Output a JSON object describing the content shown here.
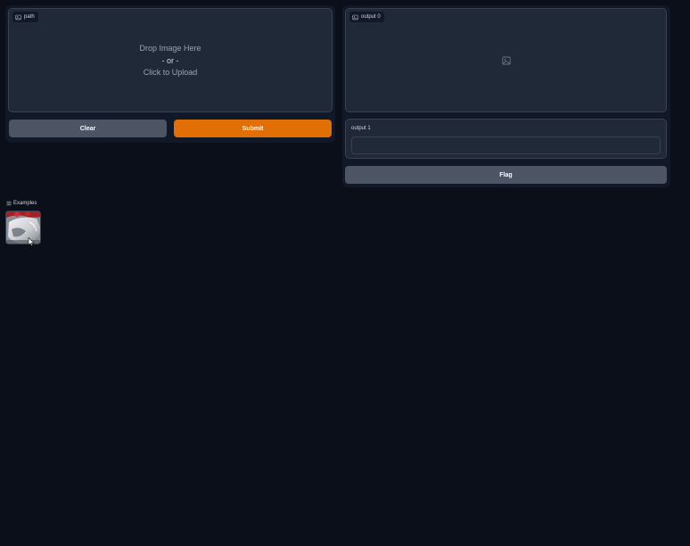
{
  "input_panel": {
    "image_label": "path",
    "drop_line1": "Drop Image Here",
    "drop_line2": "- or -",
    "drop_line3": "Click to Upload",
    "image_icon": "image-icon"
  },
  "buttons": {
    "clear_label": "Clear",
    "submit_label": "Submit",
    "flag_label": "Flag"
  },
  "output_panel": {
    "image_label": "output 0",
    "image_icon": "image-icon",
    "placeholder_icon": "image-placeholder-icon",
    "text_label": "output 1",
    "text_value": ""
  },
  "examples": {
    "header": "Examples",
    "header_icon": "list-icon",
    "items": [
      {
        "thumbnail": "example-image-thumbnail"
      }
    ]
  },
  "colors": {
    "background": "#0b0f19",
    "panel": "#111827",
    "block": "#1f2937",
    "primary": "#e16f05",
    "secondary": "#4b5563"
  }
}
